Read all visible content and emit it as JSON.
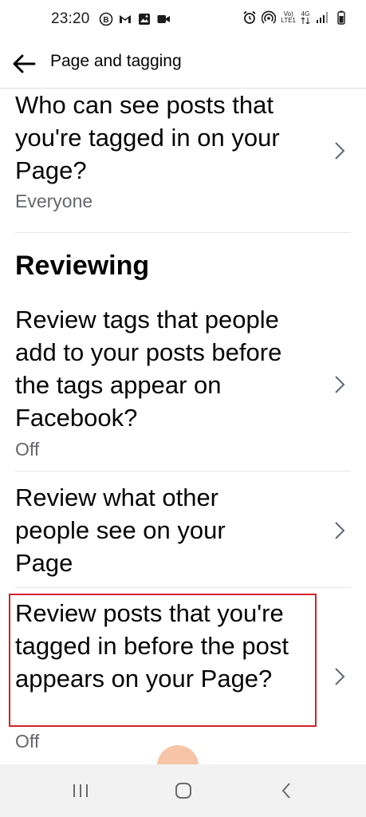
{
  "status_bar": {
    "time": "23:20",
    "network_top": "Vo)",
    "network_bottom": "LTE1",
    "net_4g": "4G"
  },
  "header": {
    "title": "Page and tagging"
  },
  "settings": {
    "tagged_visibility": {
      "title": "Who can see posts that you're tagged in on your Page?",
      "value": "Everyone"
    },
    "section_reviewing": "Reviewing",
    "review_tags": {
      "title": "Review tags that people add to your posts before the tags appear on Facebook?",
      "value": "Off"
    },
    "review_what_others_see": {
      "title": "Review what other people see on your Page"
    },
    "review_tagged_posts": {
      "title": "Review posts that you're tagged in before the post appears on your Page?",
      "value": "Off"
    }
  },
  "colors": {
    "text_primary": "#050505",
    "text_secondary": "#65676b",
    "highlight": "#d3232a",
    "divider": "#e4e6eb"
  }
}
